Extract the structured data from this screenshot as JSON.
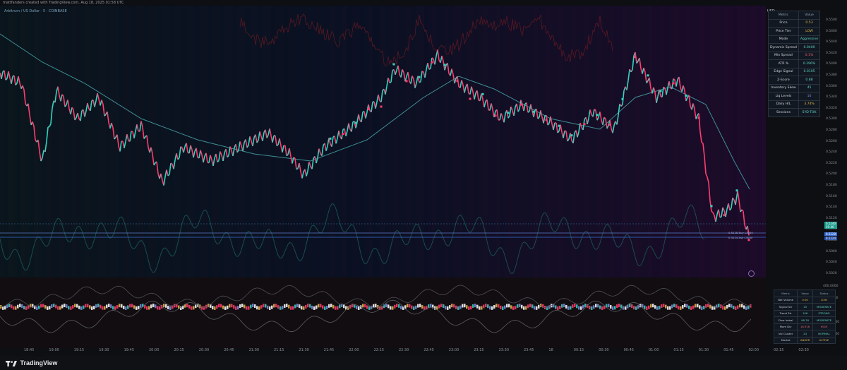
{
  "header": {
    "published_by": "mattfanders created with TradingView.com, Aug 18, 2025 01:58 UTC",
    "symbol": "Arbitrum / US Dollar · 5 · COINBASE"
  },
  "axis": {
    "currency": "USD",
    "price_ticks": [
      "0.5500",
      "0.5460",
      "0.5440",
      "0.5420",
      "0.5400",
      "0.5380",
      "0.5360",
      "0.5340",
      "0.5320",
      "0.5300",
      "0.5280",
      "0.5260",
      "0.5240",
      "0.5220",
      "0.5200",
      "0.5180",
      "0.5160",
      "0.5140",
      "0.5120",
      "0.5100",
      "0.5080",
      "0.5060",
      "0.5040",
      "0.5020"
    ],
    "sub_ticks": [
      "400.0000",
      "200.0000",
      "0.0000",
      "-200.0000",
      "-400.0000"
    ],
    "time_ticks": [
      "18:45",
      "19:00",
      "19:15",
      "19:30",
      "19:45",
      "20:00",
      "20:15",
      "20:30",
      "20:45",
      "21:00",
      "21:15",
      "21:30",
      "21:45",
      "22:00",
      "22:15",
      "22:30",
      "22:45",
      "23:00",
      "23:15",
      "23:30",
      "23:45",
      "18",
      "00:15",
      "00:30",
      "00:45",
      "01:00",
      "01:15",
      "01:30",
      "01:45",
      "02:00",
      "02:15",
      "02:30"
    ]
  },
  "price_labels": {
    "current": "0.5240",
    "current_sub": "01:46",
    "marker1": "0.5228",
    "marker2": "0.5224"
  },
  "order_labels": {
    "buy": "Buy L3000",
    "ask": "Ask L3000",
    "buy_price": "0.5228",
    "ask_price": "0.5224"
  },
  "top_table": {
    "headers": [
      "Metric",
      "Value"
    ],
    "rows": [
      {
        "metric": "Price",
        "value": "0.53",
        "color": "#e0b84a"
      },
      {
        "metric": "Price Tier",
        "value": "LOW",
        "color": "#e0b84a"
      },
      {
        "metric": "Mode",
        "value": "Aggressive",
        "color": "#5fd3c6"
      },
      {
        "metric": "Dynamic Spread",
        "value": "0.0400",
        "color": "#5fd3c6"
      },
      {
        "metric": "Min Spread",
        "value": "0.1%",
        "color": "#e0626e"
      },
      {
        "metric": "ATR %",
        "value": "0.296%",
        "color": "#5fd3c6"
      },
      {
        "metric": "Edge Signal",
        "value": "0.0105",
        "color": "#5fd3c6"
      },
      {
        "metric": "Z-Score",
        "value": "0.88",
        "color": "#5fd3c6"
      },
      {
        "metric": "Inventory Skew",
        "value": "45",
        "color": "#5fd3c6"
      },
      {
        "metric": "Liq Levels",
        "value": "10",
        "color": "#7d8de0"
      },
      {
        "metric": "Daily H/L",
        "value": "3.74%",
        "color": "#e0b84a"
      },
      {
        "metric": "Sessions",
        "value": "SYD-TOK",
        "color": "#5fd3c6"
      }
    ]
  },
  "bot_table": {
    "headers": [
      "Metric",
      "Value",
      "Status"
    ],
    "rows": [
      {
        "metric": "Net Volume",
        "value": "0.00",
        "status": "LOW",
        "color": "#e0b84a"
      },
      {
        "metric": "Signal Str",
        "value": "10",
        "status": "MODERATE",
        "color": "#5fd3c6"
      },
      {
        "metric": "Trend Str",
        "value": "106",
        "status": "STRONG",
        "color": "#5fd3c6"
      },
      {
        "metric": "Flow Imbal",
        "value": "98.76",
        "status": "MODERATE",
        "color": "#5fd3c6"
      },
      {
        "metric": "Mom Div",
        "value": "18.916",
        "status": "HIGH",
        "color": "#e0626e"
      },
      {
        "metric": "Vol Cluster",
        "value": "24",
        "status": "NORMAL",
        "color": "#5fd3c6"
      },
      {
        "metric": "Market",
        "value": "ANGER",
        "status": "ACTIVE",
        "color": "#e0b84a"
      }
    ]
  },
  "footer": {
    "brand": "TradingView"
  },
  "colors": {
    "up": "#33d3c0",
    "down": "#ff3d6e",
    "ma": "#3f8e95",
    "buy": "#3b6fd6",
    "sell": "#c63a53"
  }
}
